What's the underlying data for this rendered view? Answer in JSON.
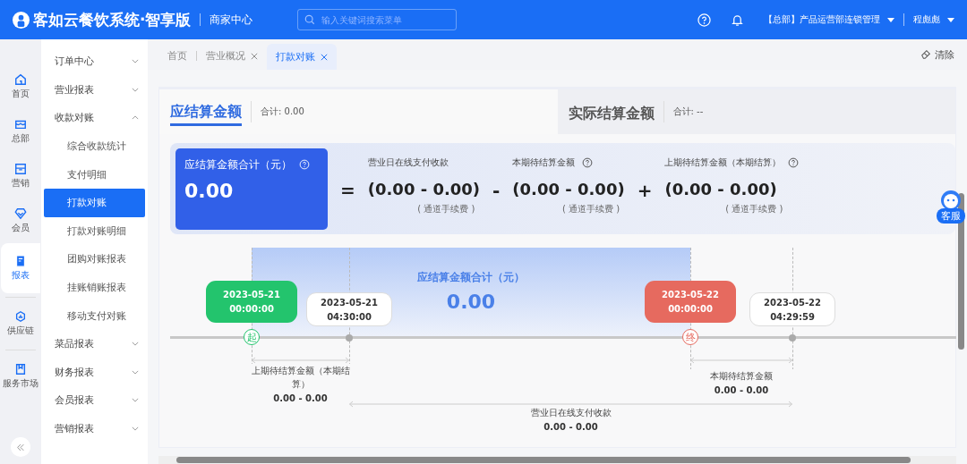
{
  "header": {
    "logo": "客如云餐饮系统·智享版",
    "center": "商家中心",
    "search": {
      "placeholder": "输入关键词搜索菜单"
    },
    "org": "【总部】产品运营部连锁管理",
    "user": "程彪彪"
  },
  "rail": [
    {
      "label": "首页",
      "selected": false
    },
    {
      "label": "总部",
      "selected": false
    },
    {
      "label": "营销",
      "selected": false
    },
    {
      "label": "会员",
      "selected": false
    },
    {
      "label": "报表",
      "selected": true
    },
    {
      "label": "供应链",
      "selected": false
    },
    {
      "label": "服务市场",
      "selected": false
    }
  ],
  "menu": [
    {
      "label": "订单中心",
      "expanded": false
    },
    {
      "label": "营业报表",
      "expanded": false
    },
    {
      "label": "收款对账",
      "expanded": true,
      "children": [
        {
          "label": "综合收款统计",
          "selected": false
        },
        {
          "label": "支付明细",
          "selected": false
        },
        {
          "label": "打款对账",
          "selected": true
        },
        {
          "label": "打款对账明细",
          "selected": false
        },
        {
          "label": "团购对账报表",
          "selected": false
        },
        {
          "label": "挂账销账报表",
          "selected": false
        },
        {
          "label": "移动支付对账",
          "selected": false
        }
      ]
    },
    {
      "label": "菜品报表",
      "expanded": false
    },
    {
      "label": "财务报表",
      "expanded": false
    },
    {
      "label": "会员报表",
      "expanded": false
    },
    {
      "label": "营销报表",
      "expanded": false
    }
  ],
  "tabs": [
    {
      "label": "首页",
      "selected": false,
      "closable": false
    },
    {
      "label": "营业概况",
      "selected": false,
      "closable": true
    },
    {
      "label": "打款对账",
      "selected": true,
      "closable": true
    }
  ],
  "clear_button": "清除",
  "summary_tabs": [
    {
      "title": "应结算金额",
      "total": "合计: 0.00",
      "selected": true
    },
    {
      "title": "实际结算金额",
      "total": "合计: --",
      "selected": false
    }
  ],
  "formula": {
    "total": {
      "label": "应结算金额合计（元）",
      "value": "0.00"
    },
    "operators": [
      "=",
      "-",
      "+"
    ],
    "terms": [
      {
        "label": "营业日在线支付收款",
        "value": "(0.00 - 0.00)",
        "note": "( 通道手续费 )",
        "help": false
      },
      {
        "label": "本期待结算金额",
        "value": "(0.00 - 0.00)",
        "note": "( 通道手续费 )",
        "help": true
      },
      {
        "label": "上期待结算金额（本期结算）",
        "value": "(0.00 - 0.00)",
        "note": "( 通道手续费 )",
        "help": true
      }
    ]
  },
  "timeline": {
    "total_label": "应结算金额合计（元）",
    "total_value": "0.00",
    "points": [
      {
        "kind": "start",
        "date": "2023-05-21",
        "time": "00:00:00",
        "mark": "起"
      },
      {
        "kind": "plain",
        "date": "2023-05-21",
        "time": "04:30:00"
      },
      {
        "kind": "end",
        "date": "2023-05-22",
        "time": "00:00:00",
        "mark": "终"
      },
      {
        "kind": "plain",
        "date": "2023-05-22",
        "time": "04:29:59"
      }
    ],
    "spans": [
      {
        "label": "上期待结算金额（本期结算）",
        "value": "0.00 - 0.00"
      },
      {
        "label": "本期待结算金额",
        "value": "0.00 - 0.00"
      },
      {
        "label": "营业日在线支付收款",
        "value": "0.00 - 0.00"
      }
    ]
  },
  "service_badge": "客服"
}
